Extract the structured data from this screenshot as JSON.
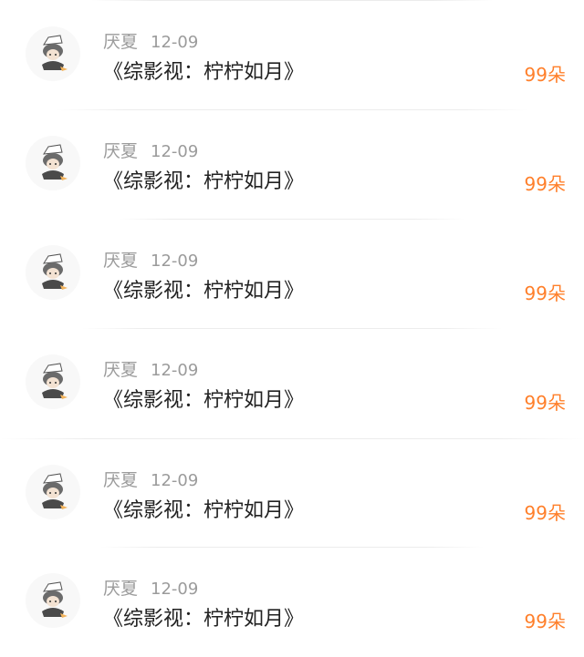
{
  "accent": "#ff7f2a",
  "comments": [
    {
      "user": "厌夏",
      "time": "12-09",
      "text": "《综影视：柠柠如月》",
      "reward": "99朵",
      "avatar_icon": "anime-character-avatar-icon"
    },
    {
      "user": "厌夏",
      "time": "12-09",
      "text": "《综影视：柠柠如月》",
      "reward": "99朵",
      "avatar_icon": "anime-character-avatar-icon"
    },
    {
      "user": "厌夏",
      "time": "12-09",
      "text": "《综影视：柠柠如月》",
      "reward": "99朵",
      "avatar_icon": "anime-character-avatar-icon"
    },
    {
      "user": "厌夏",
      "time": "12-09",
      "text": "《综影视：柠柠如月》",
      "reward": "99朵",
      "avatar_icon": "anime-character-avatar-icon"
    },
    {
      "user": "厌夏",
      "time": "12-09",
      "text": "《综影视：柠柠如月》",
      "reward": "99朵",
      "avatar_icon": "anime-character-avatar-icon"
    },
    {
      "user": "厌夏",
      "time": "12-09",
      "text": "《综影视：柠柠如月》",
      "reward": "99朵",
      "avatar_icon": "anime-character-avatar-icon"
    }
  ]
}
